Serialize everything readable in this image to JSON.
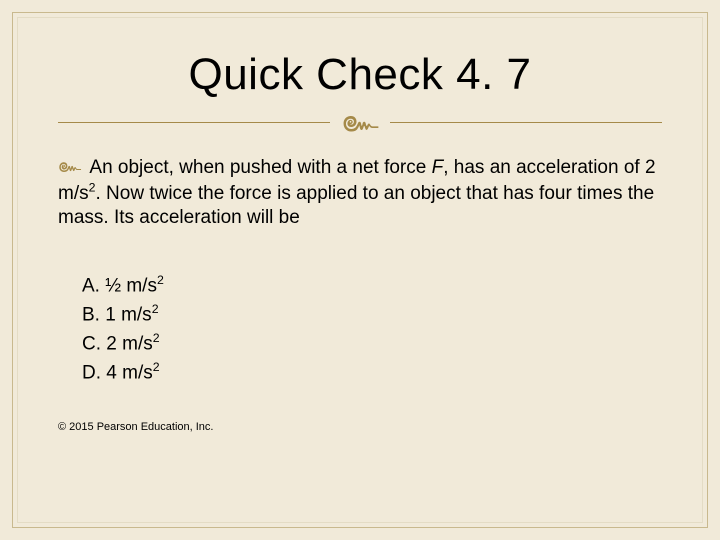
{
  "title": "Quick Check 4. 7",
  "question_pre": "An object, when pushed with a net force ",
  "question_var": "F",
  "question_mid1": ", has an acceleration of 2 m/s",
  "question_mid2": ". Now twice the force is applied to an object that has four times the mass. Its acceleration will be",
  "opts": {
    "a_label": "A.",
    "a_val": "½ m/s",
    "b_label": "B.",
    "b_val": "1 m/s",
    "c_label": "C.",
    "c_val": "2 m/s",
    "d_label": "D.",
    "d_val": "4 m/s"
  },
  "sup2": "2",
  "copyright": "© 2015 Pearson Education, Inc."
}
